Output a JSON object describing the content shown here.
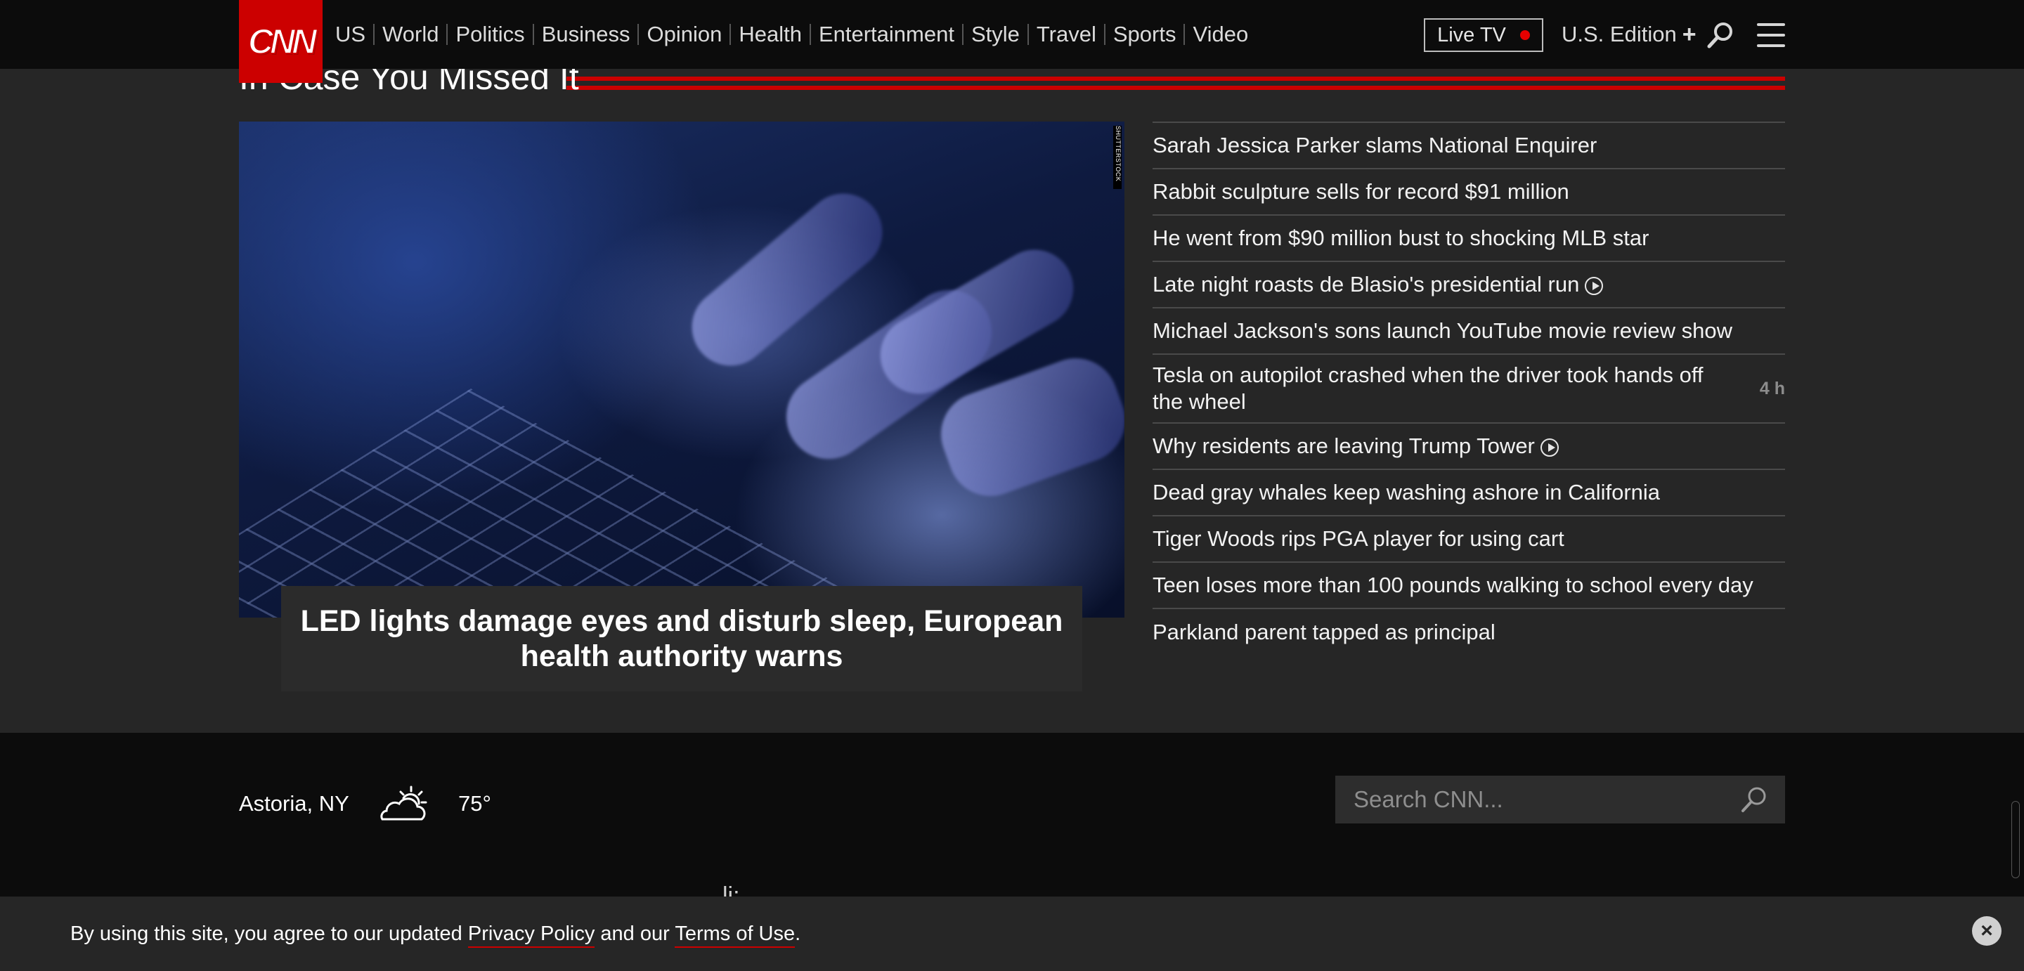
{
  "header": {
    "logo_text": "CNN",
    "nav": [
      "US",
      "World",
      "Politics",
      "Business",
      "Opinion",
      "Health",
      "Entertainment",
      "Style",
      "Travel",
      "Sports",
      "Video"
    ],
    "live_tv": "Live TV",
    "edition": "U.S. Edition",
    "edition_plus": "+"
  },
  "section": {
    "title": "In Case You Missed It",
    "hero_caption": "LED lights damage eyes and disturb sleep, European health authority warns",
    "hero_credit": "SHUTTERSTOCK",
    "headlines": [
      {
        "text": "Sarah Jessica Parker slams National Enquirer"
      },
      {
        "text": "Rabbit sculpture sells for record $91 million"
      },
      {
        "text": "He went from $90 million bust to shocking MLB star"
      },
      {
        "text": "Late night roasts de Blasio's presidential run",
        "video": true
      },
      {
        "text": "Michael Jackson's sons launch YouTube movie review show"
      },
      {
        "text": "Tesla on autopilot crashed when the driver took hands off the wheel",
        "time": "4 h"
      },
      {
        "text": "Why residents are leaving Trump Tower",
        "video": true
      },
      {
        "text": "Dead gray whales keep washing ashore in California"
      },
      {
        "text": "Tiger Woods rips PGA player for using cart"
      },
      {
        "text": "Teen loses more than 100 pounds walking to school every day"
      },
      {
        "text": "Parkland parent tapped as principal"
      }
    ]
  },
  "footer": {
    "weather_location": "Astoria, NY",
    "weather_icon": "partly-cloudy-icon",
    "weather_temp": "75°",
    "search_placeholder": "Search CNN...",
    "peek_text": "li:"
  },
  "cookie": {
    "prefix": "By using this site, you agree to our updated ",
    "privacy_link": "Privacy Policy",
    "middle": " and our ",
    "terms_link": "Terms of Use",
    "suffix": "."
  },
  "colors": {
    "brand_red": "#cc0000",
    "page_bg": "#262626",
    "header_bg": "#0c0c0c"
  }
}
